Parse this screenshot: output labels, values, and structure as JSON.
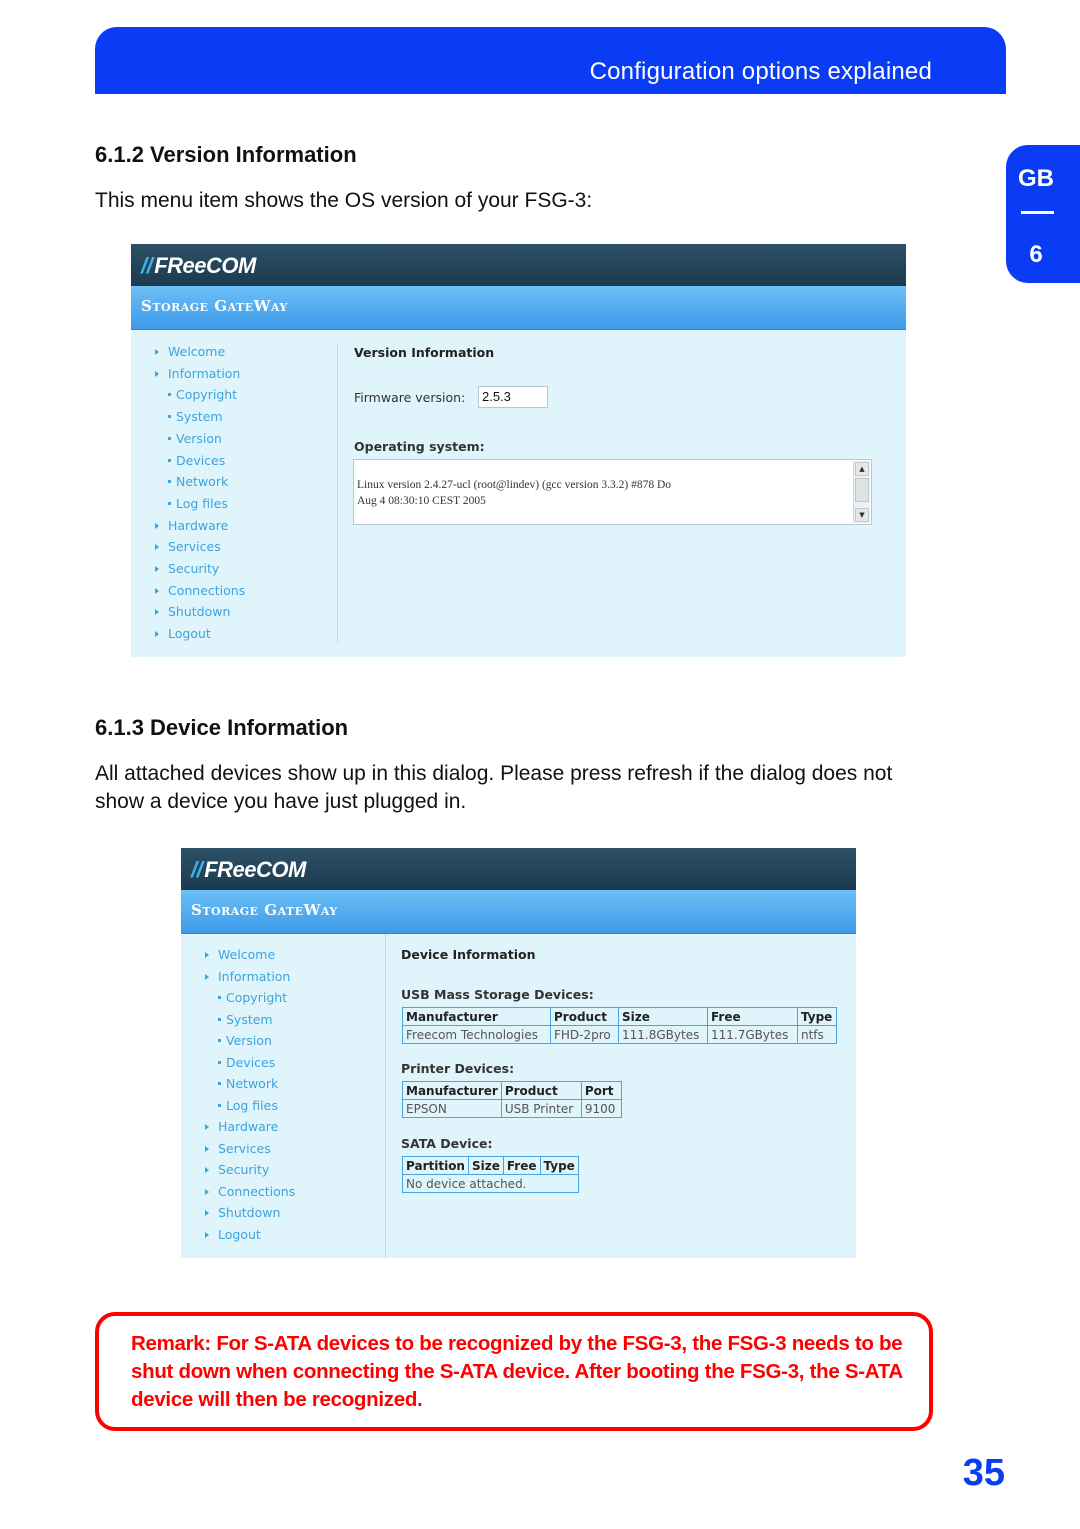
{
  "header": {
    "title": "Configuration options explained"
  },
  "side_tab": {
    "language": "GB",
    "chapter": "6"
  },
  "section_version": {
    "heading": "6.1.2 Version Information",
    "intro": "This menu item shows the OS version of your FSG-3:"
  },
  "section_device": {
    "heading": "6.1.3 Device Information",
    "intro": "All attached devices show up in this dialog. Please press refresh if the dialog does not show a device you have just plugged in."
  },
  "app": {
    "logo_slash": "//",
    "logo_text": "FReeCOM",
    "subtitle": "Storage GateWay",
    "nav": [
      {
        "label": "Welcome",
        "type": "main"
      },
      {
        "label": "Information",
        "type": "main"
      },
      {
        "label": "Copyright",
        "type": "sub"
      },
      {
        "label": "System",
        "type": "sub"
      },
      {
        "label": "Version",
        "type": "sub"
      },
      {
        "label": "Devices",
        "type": "sub"
      },
      {
        "label": "Network",
        "type": "sub"
      },
      {
        "label": "Log files",
        "type": "sub"
      },
      {
        "label": "Hardware",
        "type": "main"
      },
      {
        "label": "Services",
        "type": "main"
      },
      {
        "label": "Security",
        "type": "main"
      },
      {
        "label": "Connections",
        "type": "main"
      },
      {
        "label": "Shutdown",
        "type": "main"
      },
      {
        "label": "Logout",
        "type": "main"
      }
    ]
  },
  "version_panel": {
    "title": "Version Information",
    "firmware_label": "Firmware version:",
    "firmware_value": "2.5.3",
    "os_label": "Operating system:",
    "os_text": "Linux version 2.4.27-ucl (root@lindev) (gcc version 3.3.2) #878 Do\nAug 4 08:30:10 CEST 2005"
  },
  "device_panel": {
    "title": "Device Information",
    "usb": {
      "label": "USB Mass Storage Devices:",
      "columns": [
        "Manufacturer",
        "Product",
        "Size",
        "Free",
        "Type"
      ],
      "rows": [
        [
          "Freecom Technologies",
          "FHD-2pro",
          "111.8GBytes",
          "111.7GBytes",
          "ntfs"
        ]
      ]
    },
    "printer": {
      "label": "Printer Devices:",
      "columns": [
        "Manufacturer",
        "Product",
        "Port"
      ],
      "rows": [
        [
          "EPSON",
          "USB Printer",
          "9100"
        ]
      ]
    },
    "sata": {
      "label": "SATA Device:",
      "columns": [
        "Partition",
        "Size",
        "Free",
        "Type"
      ],
      "empty_message": "No device attached."
    }
  },
  "remark": {
    "text": "Remark: For S-ATA devices to be recognized by the FSG-3, the FSG-3 needs to be shut down when connecting the S-ATA device. After booting the FSG-3, the S-ATA device will then be recognized."
  },
  "page_number": "35",
  "colors": {
    "brand_blue": "#0a3cf5",
    "remark_red": "#ff0000",
    "nav_link": "#3da4dc"
  }
}
